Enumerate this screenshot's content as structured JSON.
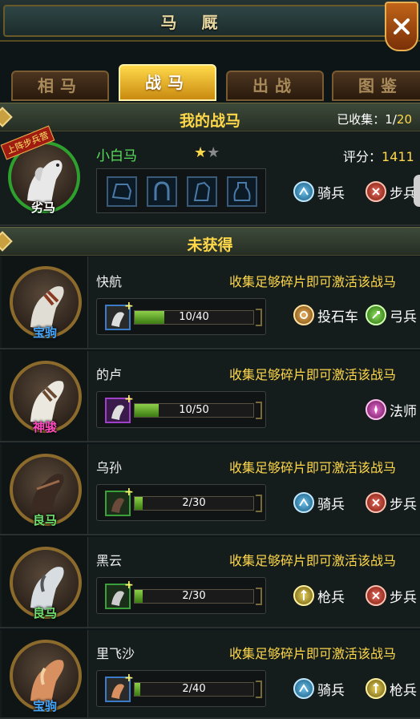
{
  "window": {
    "title": "马 厩",
    "close_label": "close"
  },
  "tabs": [
    {
      "label": "相马",
      "active": false
    },
    {
      "label": "战马",
      "active": true
    },
    {
      "label": "出战",
      "active": false
    },
    {
      "label": "图鉴",
      "active": false
    }
  ],
  "my_horses": {
    "section_title": "我的战马",
    "collected_label": "已收集：",
    "collected_current": "1",
    "collected_sep": "/",
    "collected_total": "20",
    "horse": {
      "name": "小白马",
      "grade": "劣马",
      "ribbon": "上阵步兵营",
      "stars_filled": 1,
      "stars_total": 2,
      "score_label": "评分：",
      "score_value": "1411",
      "units": [
        "骑兵",
        "步兵"
      ]
    }
  },
  "unacquired": {
    "section_title": "未获得",
    "hint": "收集足够碎片即可激活该战马",
    "horses": [
      {
        "name": "快航",
        "grade": "宝驹",
        "progress": "10/40",
        "current": 10,
        "total": 40,
        "units": [
          "投石车",
          "弓兵"
        ]
      },
      {
        "name": "的卢",
        "grade": "神骏",
        "progress": "10/50",
        "current": 10,
        "total": 50,
        "units": [
          "法师"
        ]
      },
      {
        "name": "乌孙",
        "grade": "良马",
        "progress": "2/30",
        "current": 2,
        "total": 30,
        "units": [
          "骑兵",
          "步兵"
        ]
      },
      {
        "name": "黑云",
        "grade": "良马",
        "progress": "2/30",
        "current": 2,
        "total": 30,
        "units": [
          "枪兵",
          "步兵"
        ]
      },
      {
        "name": "里飞沙",
        "grade": "宝驹",
        "progress": "2/40",
        "current": 2,
        "total": 40,
        "units": [
          "骑兵",
          "枪兵"
        ]
      }
    ]
  },
  "colors": {
    "accent_gold": "#ffd84a",
    "name_green": "#5ae05a",
    "bar_fill": "#6ab02a"
  }
}
